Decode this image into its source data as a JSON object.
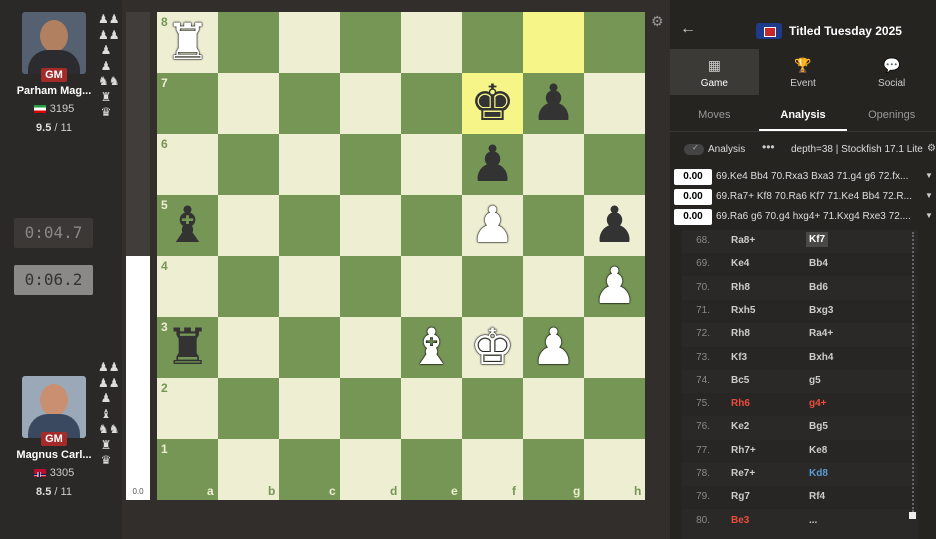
{
  "players": {
    "top": {
      "title": "GM",
      "name": "Parham Mag...",
      "rating": "3195",
      "score": "9.5",
      "rounds": "11",
      "captured": [
        "♟♟",
        "♟♟",
        "♟",
        "♟",
        "♞♞",
        "♜",
        "♛"
      ]
    },
    "bottom": {
      "title": "GM",
      "name": "Magnus Carl...",
      "rating": "3305",
      "score": "8.5",
      "rounds": "11",
      "captured": [
        "♟♟",
        "♟♟",
        "♟",
        "♝",
        "♞♞",
        "♜",
        "♛"
      ]
    }
  },
  "clocks": {
    "top": "0:04.7",
    "bottom": "0:06.2"
  },
  "eval": {
    "label": "0.0",
    "white_fraction": 0.5
  },
  "board": {
    "files": [
      "a",
      "b",
      "c",
      "d",
      "e",
      "f",
      "g",
      "h"
    ],
    "ranks": [
      "8",
      "7",
      "6",
      "5",
      "4",
      "3",
      "2",
      "1"
    ],
    "highlights": [
      "f7",
      "g8"
    ],
    "pieces": [
      {
        "square": "a8",
        "color": "w",
        "glyph": "♜"
      },
      {
        "square": "f7",
        "color": "b",
        "glyph": "♚"
      },
      {
        "square": "g7",
        "color": "b",
        "glyph": "♟"
      },
      {
        "square": "f6",
        "color": "b",
        "glyph": "♟"
      },
      {
        "square": "a5",
        "color": "b",
        "glyph": "♝"
      },
      {
        "square": "f5",
        "color": "w",
        "glyph": "♟"
      },
      {
        "square": "h5",
        "color": "b",
        "glyph": "♟"
      },
      {
        "square": "h4",
        "color": "w",
        "glyph": "♟"
      },
      {
        "square": "a3",
        "color": "b",
        "glyph": "♜"
      },
      {
        "square": "e3",
        "color": "w",
        "glyph": "♝"
      },
      {
        "square": "f3",
        "color": "w",
        "glyph": "♚"
      },
      {
        "square": "g3",
        "color": "w",
        "glyph": "♟"
      }
    ]
  },
  "panel": {
    "back_icon": "←",
    "event_title": "Titled Tuesday 2025",
    "tabs": [
      {
        "id": "game",
        "label": "Game",
        "icon": "▦",
        "active": true
      },
      {
        "id": "event",
        "label": "Event",
        "icon": "🏆",
        "active": false
      },
      {
        "id": "social",
        "label": "Social",
        "icon": "💬",
        "active": false
      }
    ],
    "subtabs": [
      {
        "id": "moves",
        "label": "Moves",
        "active": false
      },
      {
        "id": "analysis",
        "label": "Analysis",
        "active": true
      },
      {
        "id": "openings",
        "label": "Openings",
        "active": false
      }
    ],
    "analysis_label": "Analysis",
    "engine": "depth=38 | Stockfish 17.1 Lite",
    "lines": [
      {
        "eval": "0.00",
        "text": "69.Ke4 Bb4 70.Rxa3 Bxa3 71.g4 g6 72.fx..."
      },
      {
        "eval": "0.00",
        "text": "69.Ra7+ Kf8 70.Ra6 Kf7 71.Ke4 Bb4 72.R..."
      },
      {
        "eval": "0.00",
        "text": "69.Ra6 g6 70.g4 hxg4+ 71.Kxg4 Rxe3 72...."
      }
    ],
    "moves": [
      {
        "num": "68.",
        "white": "Ra8+",
        "black": "Kf7",
        "current": true
      },
      {
        "num": "69.",
        "white": "Ke4",
        "black": "Bb4"
      },
      {
        "num": "70.",
        "white": "Rh8",
        "black": "Bd6"
      },
      {
        "num": "71.",
        "white": "Rxh5",
        "black": "Bxg3"
      },
      {
        "num": "72.",
        "white": "Rh8",
        "black": "Ra4+"
      },
      {
        "num": "73.",
        "white": "Kf3",
        "black": "Bxh4"
      },
      {
        "num": "74.",
        "white": "Bc5",
        "black": "g5"
      },
      {
        "num": "75.",
        "white": "Rh6",
        "black": "g4+",
        "white_class": "red",
        "black_class": "red"
      },
      {
        "num": "76.",
        "white": "Ke2",
        "black": "Bg5"
      },
      {
        "num": "77.",
        "white": "Rh7+",
        "black": "Ke8"
      },
      {
        "num": "78.",
        "white": "Re7+",
        "black": "Kd8",
        "black_class": "blue"
      },
      {
        "num": "79.",
        "white": "Rg7",
        "black": "Rf4"
      },
      {
        "num": "80.",
        "white": "Be3",
        "black": "...",
        "white_class": "red"
      }
    ]
  }
}
